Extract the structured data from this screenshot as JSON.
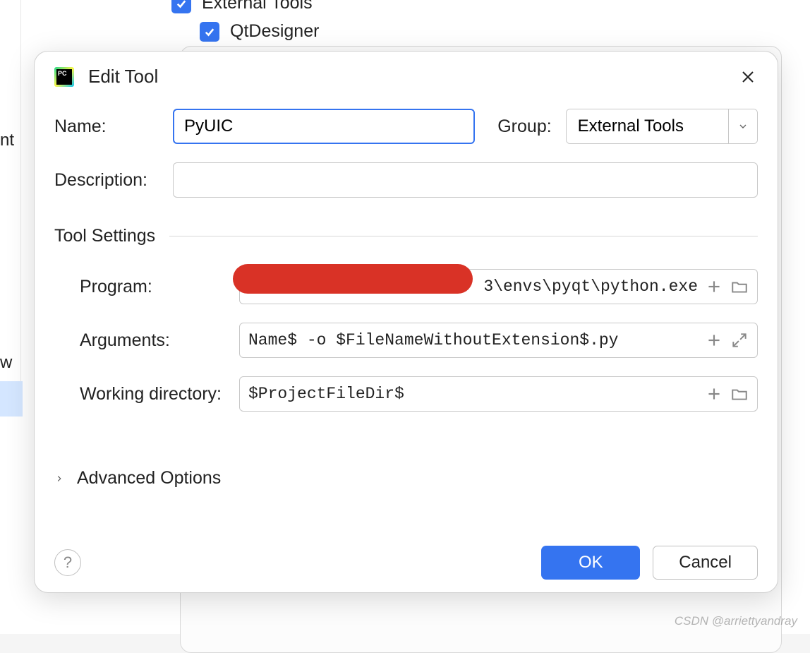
{
  "background": {
    "parent_item": "External Tools",
    "child_item": "QtDesigner",
    "sidebar_text1": "nt",
    "sidebar_text2": "w"
  },
  "dialog": {
    "title": "Edit Tool",
    "name_label": "Name:",
    "name_value": "PyUIC",
    "group_label": "Group:",
    "group_value": "External Tools",
    "description_label": "Description:",
    "description_value": "",
    "tool_settings_header": "Tool Settings",
    "program_label": "Program:",
    "program_value": "3\\envs\\pyqt\\python.exe",
    "arguments_label": "Arguments:",
    "arguments_value": "Name$ -o $FileNameWithoutExtension$.py",
    "working_dir_label": "Working directory:",
    "working_dir_value": "$ProjectFileDir$",
    "advanced_label": "Advanced Options",
    "ok_label": "OK",
    "cancel_label": "Cancel",
    "help_label": "?"
  },
  "watermark": "CSDN @arriettyandray"
}
